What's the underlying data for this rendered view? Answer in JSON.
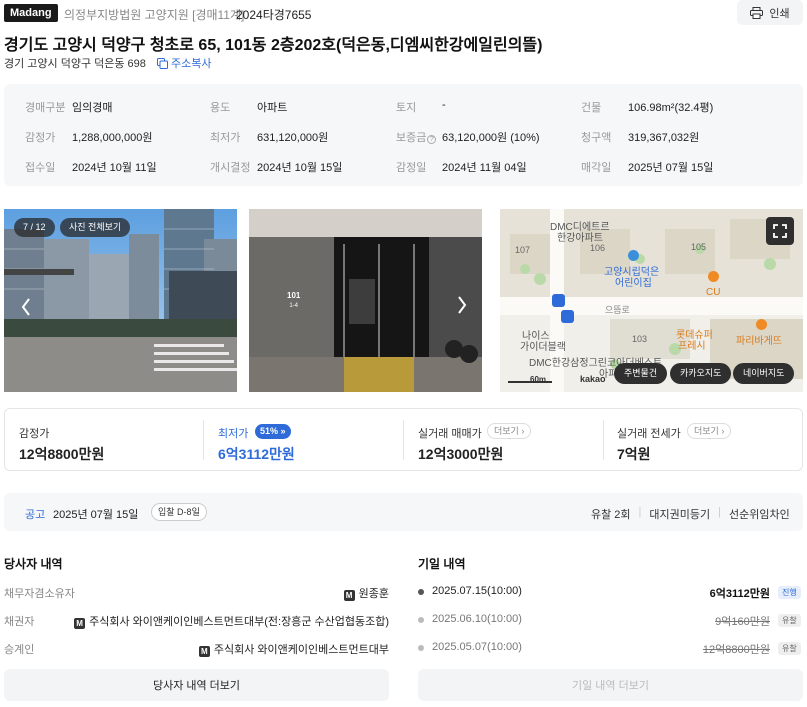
{
  "header": {
    "logo": "Madang",
    "court": "의정부지방법원 고양지원 [경매11계]",
    "case_no": "2024타경7655",
    "print_label": "인쇄"
  },
  "title": "경기도 고양시 덕양구 청초로 65, 101동 2층202호(덕은동,디엠씨한강에일린의뜰)",
  "address": {
    "jibun": "경기 고양시 덕양구 덕은동 698",
    "copy_label": "주소복사"
  },
  "info": [
    {
      "label": "경매구분",
      "value": "임의경매"
    },
    {
      "label": "용도",
      "value": "아파트"
    },
    {
      "label": "토지",
      "value": "-"
    },
    {
      "label": "건물",
      "value": "106.98m²(32.4평)"
    },
    {
      "label": "감정가",
      "value": "1,288,000,000원"
    },
    {
      "label": "최저가",
      "value": "631,120,000원"
    },
    {
      "label": "보증금",
      "value": "63,120,000원 (10%)"
    },
    {
      "label": "청구액",
      "value": "319,367,032원"
    },
    {
      "label": "접수일",
      "value": "2024년 10월 11일"
    },
    {
      "label": "개시결정",
      "value": "2024년 10월 15일"
    },
    {
      "label": "감정일",
      "value": "2024년 11월 04일"
    },
    {
      "label": "매각일",
      "value": "2025년 07월 15일"
    }
  ],
  "gallery": {
    "counter": "7 / 12",
    "view_all": "사진 전체보기"
  },
  "photo2": {
    "sign": "101",
    "sign2": "1-4"
  },
  "map": {
    "pois": [
      "DMC디에트르",
      "한강아파트",
      "107",
      "106",
      "105",
      "고양시립덕은",
      "어린이집",
      "CU",
      "으뜸로",
      "나이스",
      "가이더블랙",
      "103",
      "롯데슈퍼",
      "프레시",
      "파리바게뜨",
      "DMC한강삼정그린코아더베스트",
      "아파트"
    ],
    "scale": "60m",
    "brand": "kakao",
    "buttons": [
      "주변물건",
      "카카오지도",
      "네이버지도"
    ]
  },
  "prices": {
    "appraisal": {
      "label": "감정가",
      "value": "12억8800만원"
    },
    "minimum": {
      "label": "최저가",
      "badge": "51%",
      "value": "6억3112만원"
    },
    "trade": {
      "label": "실거래 매매가",
      "more": "더보기",
      "value": "12억3000만원"
    },
    "jeonse": {
      "label": "실거래 전세가",
      "more": "더보기",
      "value": "7억원"
    }
  },
  "notice": {
    "label": "공고",
    "date": "2025년 07월 15일",
    "dday": "입찰 D-8일",
    "flags": [
      "유찰 2회",
      "대지권미등기",
      "선순위임차인"
    ]
  },
  "parties": {
    "title": "당사자 내역",
    "rows": [
      {
        "role": "채무자겸소유자",
        "name": "원종훈"
      },
      {
        "role": "채권자",
        "name": "주식회사 와이앤케이인베스트먼트대부(전:장흥군 수산업협동조합)"
      },
      {
        "role": "승계인",
        "name": "주식회사 와이앤케이인베스트먼트대부"
      }
    ],
    "more": "당사자 내역 더보기"
  },
  "dates": {
    "title": "기일 내역",
    "rows": [
      {
        "date": "2025.07.15(10:00)",
        "price": "6억3112만원",
        "status": "진행"
      },
      {
        "date": "2025.06.10(10:00)",
        "price": "9억160만원",
        "status": "유찰"
      },
      {
        "date": "2025.05.07(10:00)",
        "price": "12억8800만원",
        "status": "유찰"
      }
    ],
    "more": "기일 내역 더보기"
  },
  "colors": {
    "accent": "#2e6bd8",
    "dark": "#1a1a1a",
    "panel": "#f6f7f9"
  }
}
